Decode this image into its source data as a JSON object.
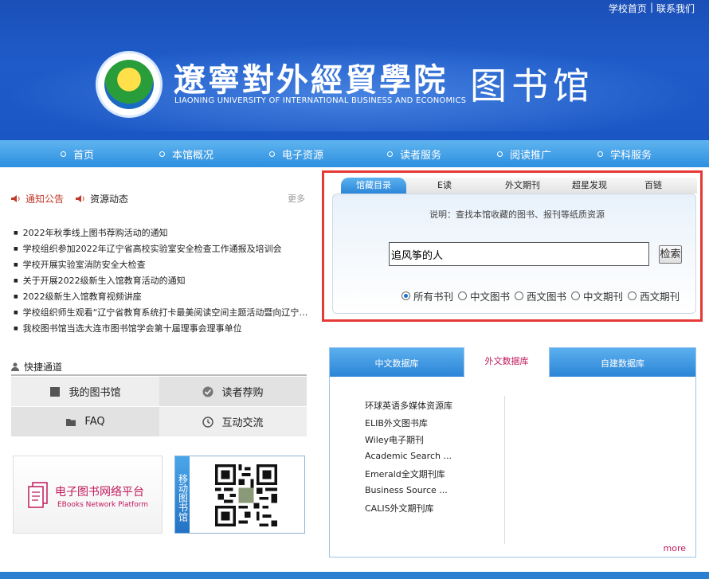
{
  "toplinks": {
    "home": "学校首页",
    "sep": "|",
    "contact": "联系我们"
  },
  "header": {
    "school_name": "遼寧對外經貿學院",
    "school_en": "LIAONING UNIVERSITY OF INTERNATIONAL BUSINESS AND ECONOMICS",
    "library": "图书馆"
  },
  "nav": [
    "首页",
    "本馆概况",
    "电子资源",
    "读者服务",
    "阅读推广",
    "学科服务"
  ],
  "news": {
    "tabs": [
      "通知公告",
      "资源动态"
    ],
    "more": "更多",
    "items": [
      "2022年秋季线上图书荐购活动的通知",
      "学校组织参加2022年辽宁省高校实验室安全检查工作通报及培训会",
      "学校开展实验室消防安全大检查",
      "关于开展2022级新生入馆教育活动的通知",
      "2022级新生入馆教育视频讲座",
      "学校组织师生观看“辽宁省教育系统打卡最美阅读空间主题活动暨向辽宁…",
      "我校图书馆当选大连市图书馆学会第十届理事会理事单位"
    ]
  },
  "quick": {
    "title": "快捷通道",
    "items": [
      "我的图书馆",
      "读者荐购",
      "FAQ",
      "互动交流"
    ]
  },
  "ebook": {
    "cn": "电子图书网络平台",
    "en": "EBooks Network Platform"
  },
  "mobile": {
    "label": "移动图书馆"
  },
  "search": {
    "tabs": [
      "馆藏目录",
      "E读",
      "外文期刊",
      "超星发现",
      "百链"
    ],
    "note": "说明：查找本馆收藏的图书、报刊等纸质资源",
    "input_value": "追风筝的人",
    "button": "检索",
    "radios": [
      "所有书刊",
      "中文图书",
      "西文图书",
      "中文期刊",
      "西文期刊"
    ],
    "selected_radio": "所有书刊"
  },
  "databases": {
    "tabs": [
      "中文数据库",
      "外文数据库",
      "自建数据库"
    ],
    "active_tab": "外文数据库",
    "items": [
      "环球英语多媒体资源库",
      "ELIB外文图书库",
      "Wiley电子期刊",
      "Academic Search ...",
      "Emerald全文期刊库",
      "Business Source ...",
      "CALIS外文期刊库"
    ],
    "more": "more"
  },
  "colors": {
    "header": "#1b4fb8",
    "nav": "#2d8fe0",
    "highlight_border": "#e53935",
    "accent": "#c2185b"
  }
}
